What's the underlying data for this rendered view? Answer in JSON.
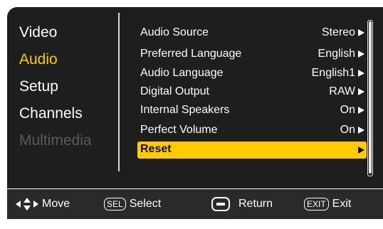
{
  "categories": [
    {
      "label": "Video",
      "state": "normal"
    },
    {
      "label": "Audio",
      "state": "active"
    },
    {
      "label": "Setup",
      "state": "normal"
    },
    {
      "label": "Channels",
      "state": "normal"
    },
    {
      "label": "Multimedia",
      "state": "disabled"
    }
  ],
  "audio_menu": [
    {
      "label": "Audio Source",
      "value": "Stereo"
    },
    {
      "label": "Preferred Language",
      "value": "English"
    },
    {
      "label": "Audio Language",
      "value": "English1"
    },
    {
      "label": "Digital Output",
      "value": "RAW"
    },
    {
      "label": "Internal Speakers",
      "value": "On"
    },
    {
      "label": "Perfect Volume",
      "value": "On"
    },
    {
      "label": "Reset",
      "value": "",
      "selected": true
    }
  ],
  "footer": {
    "move_label": "Move",
    "sel_key": "SEL",
    "select_label": "Select",
    "return_label": "Return",
    "exit_key": "EXIT",
    "exit_label": "Exit"
  },
  "colors": {
    "panel_bg": "#1e1e1e",
    "footer_bg": "#2a2a2a",
    "accent": "#ffcc00",
    "disabled": "#5a5a5a"
  }
}
